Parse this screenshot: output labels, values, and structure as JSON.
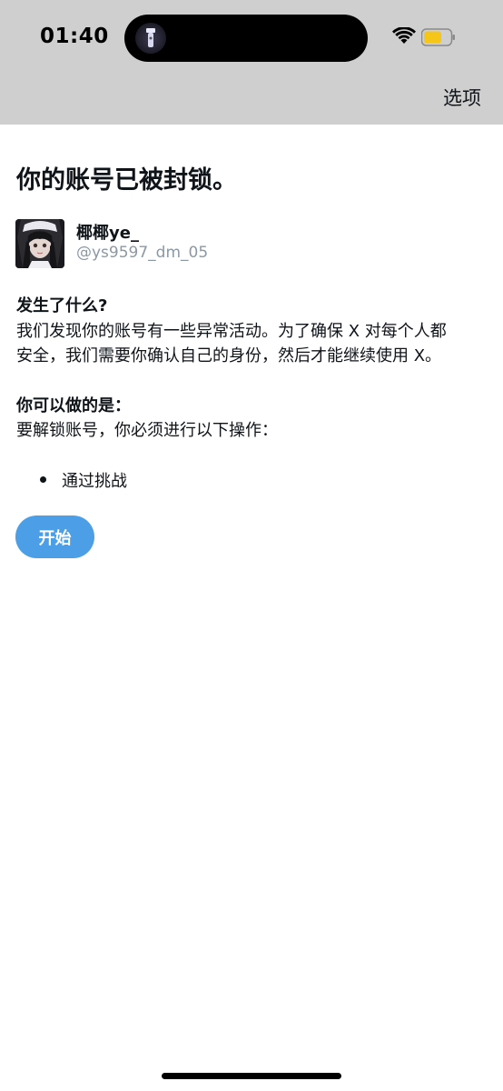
{
  "status_bar": {
    "time": "01:40",
    "icons": [
      "flashlight-icon",
      "wifi-icon",
      "battery-icon"
    ],
    "battery_color": "#f5c518"
  },
  "header": {
    "options_label": "选项"
  },
  "main": {
    "title": "你的账号已被封锁。",
    "user": {
      "display_name": "椰椰ye_",
      "handle": "@ys9597_dm_05"
    },
    "what_happened": {
      "heading": "发生了什么?",
      "lines": [
        "我们发现你的账号有一些异常活动。为了确保 X 对每个人都",
        "安全，我们需要你确认自己的身份，然后才能继续使用 X。"
      ]
    },
    "what_you_can_do": {
      "heading": "你可以做的是：",
      "text": "要解锁账号，你必须进行以下操作：",
      "items": [
        "通过挑战"
      ]
    },
    "start_button_label": "开始"
  },
  "colors": {
    "top_bar": "#cfcfcf",
    "accent_button": "#4c9ee6",
    "handle_text": "#8b98a5"
  }
}
